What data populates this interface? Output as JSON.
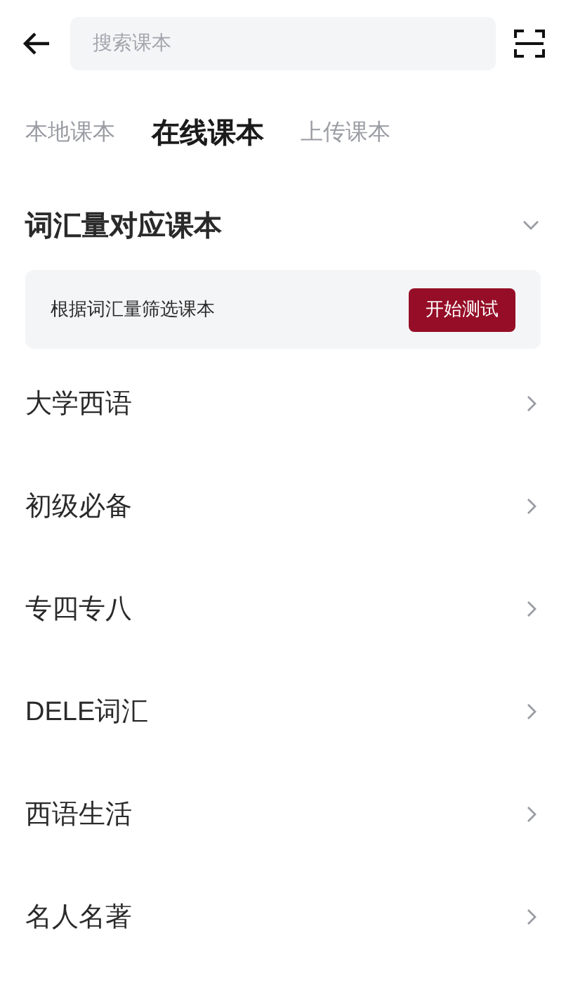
{
  "search": {
    "placeholder": "搜索课本"
  },
  "tabs": [
    {
      "label": "本地课本",
      "selected": false
    },
    {
      "label": "在线课本",
      "selected": true
    },
    {
      "label": "上传课本",
      "selected": false
    }
  ],
  "section": {
    "title": "词汇量对应课本",
    "expanded": true,
    "hint": "根据词汇量筛选课本",
    "button": "开始测试"
  },
  "categories": [
    {
      "label": "大学西语"
    },
    {
      "label": "初级必备"
    },
    {
      "label": "专四专八"
    },
    {
      "label": "DELE词汇"
    },
    {
      "label": "西语生活"
    },
    {
      "label": "名人名著"
    }
  ]
}
